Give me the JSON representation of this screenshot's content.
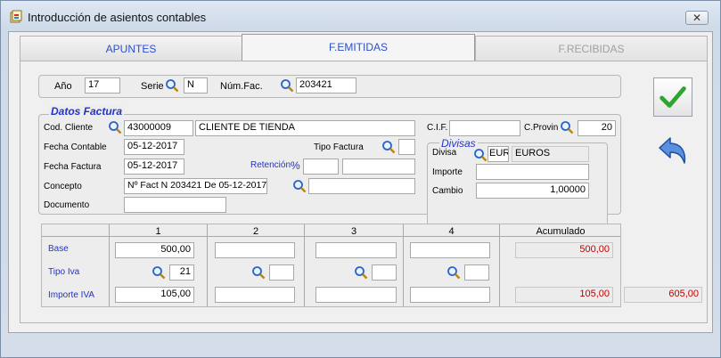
{
  "window": {
    "title": "Introducción de asientos contables",
    "close_label": "✕"
  },
  "tabs": [
    {
      "label": "APUNTES"
    },
    {
      "label": "F.EMITIDAS"
    },
    {
      "label": "F.RECIBIDAS"
    }
  ],
  "header": {
    "year_label": "Año",
    "year_value": "17",
    "serie_label": "Serie",
    "serie_value": "N",
    "numfac_label": "Núm.Fac.",
    "numfac_value": "203421"
  },
  "factura": {
    "legend": "Datos Factura",
    "cod_cliente_label": "Cod. Cliente",
    "cod_cliente_value": "43000009",
    "cliente_nombre": "CLIENTE DE TIENDA",
    "cif_label": "C.I.F.",
    "cif_value": "",
    "cprovin_label": "C.Provin",
    "cprovin_value": "20",
    "fecha_contable_label": "Fecha Contable",
    "fecha_contable_value": "05-12-2017",
    "tipo_factura_label": "Tipo Factura",
    "tipo_factura_value": "",
    "fecha_factura_label": "Fecha Factura",
    "fecha_factura_value": "05-12-2017",
    "retencion_label": "Retención",
    "retencion_pct": "%",
    "concepto_label": "Concepto",
    "concepto_value": "Nº Fact N 203421 De 05-12-2017",
    "documento_label": "Documento",
    "documento_value": ""
  },
  "divisas": {
    "legend": "Divisas",
    "divisa_label": "Divisa",
    "divisa_code": "EUR",
    "divisa_name": "EUROS",
    "importe_label": "Importe",
    "importe_value": "",
    "cambio_label": "Cambio",
    "cambio_value": "1,00000"
  },
  "iva_table": {
    "columns": [
      "1",
      "2",
      "3",
      "4",
      "Acumulado"
    ],
    "base_label": "Base",
    "tipo_iva_label": "Tipo Iva",
    "importe_iva_label": "Importe IVA",
    "base_values": [
      "500,00",
      "",
      "",
      ""
    ],
    "tipo_values": [
      "21",
      "",
      "",
      ""
    ],
    "importe_values": [
      "105,00",
      "",
      "",
      ""
    ],
    "acum_base": "500,00",
    "acum_importe": "105,00",
    "total": "605,00"
  },
  "colors": {
    "accent": "#2233cc",
    "negative": "#c00000",
    "confirm": "#2fa52f",
    "undo": "#2b63c7"
  }
}
